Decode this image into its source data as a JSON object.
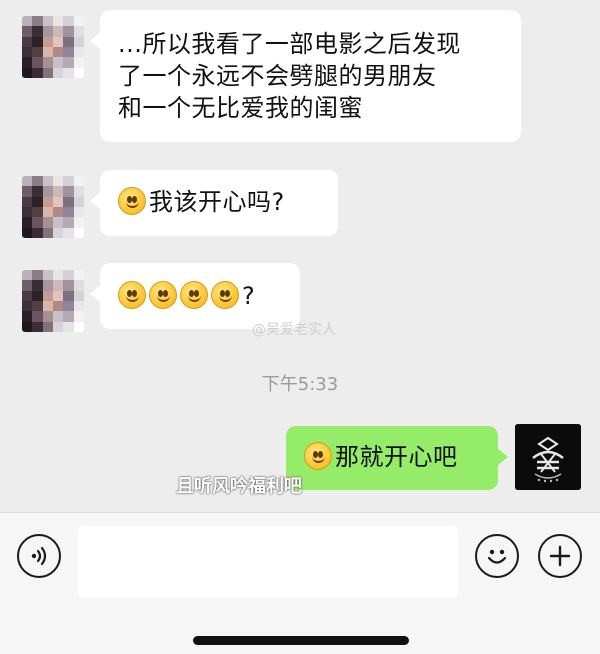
{
  "messages": [
    {
      "sender": "contact",
      "lines": [
        "...所以我看了一部电影之后发现",
        "了一个永远不会劈腿的男朋友",
        "和一个无比爱我的闺蜜"
      ]
    },
    {
      "sender": "contact",
      "emoji": "smile-emoji",
      "text": "我该开心吗?"
    },
    {
      "sender": "contact",
      "emoji_count": 4,
      "text": "?"
    },
    {
      "sender": "me",
      "emoji": "smile-emoji",
      "text": "那就开心吧"
    }
  ],
  "timestamp": "下午5:33",
  "watermarks": {
    "mid": "@吴爱老实人",
    "bottom": "且听风吟福利吧"
  },
  "input_bar": {
    "voice_icon": "voice-icon",
    "emoji_icon": "emoji-icon",
    "plus_icon": "plus-icon"
  },
  "colors": {
    "incoming_bubble": "#ffffff",
    "outgoing_bubble": "#95ec69",
    "background": "#ededed"
  }
}
